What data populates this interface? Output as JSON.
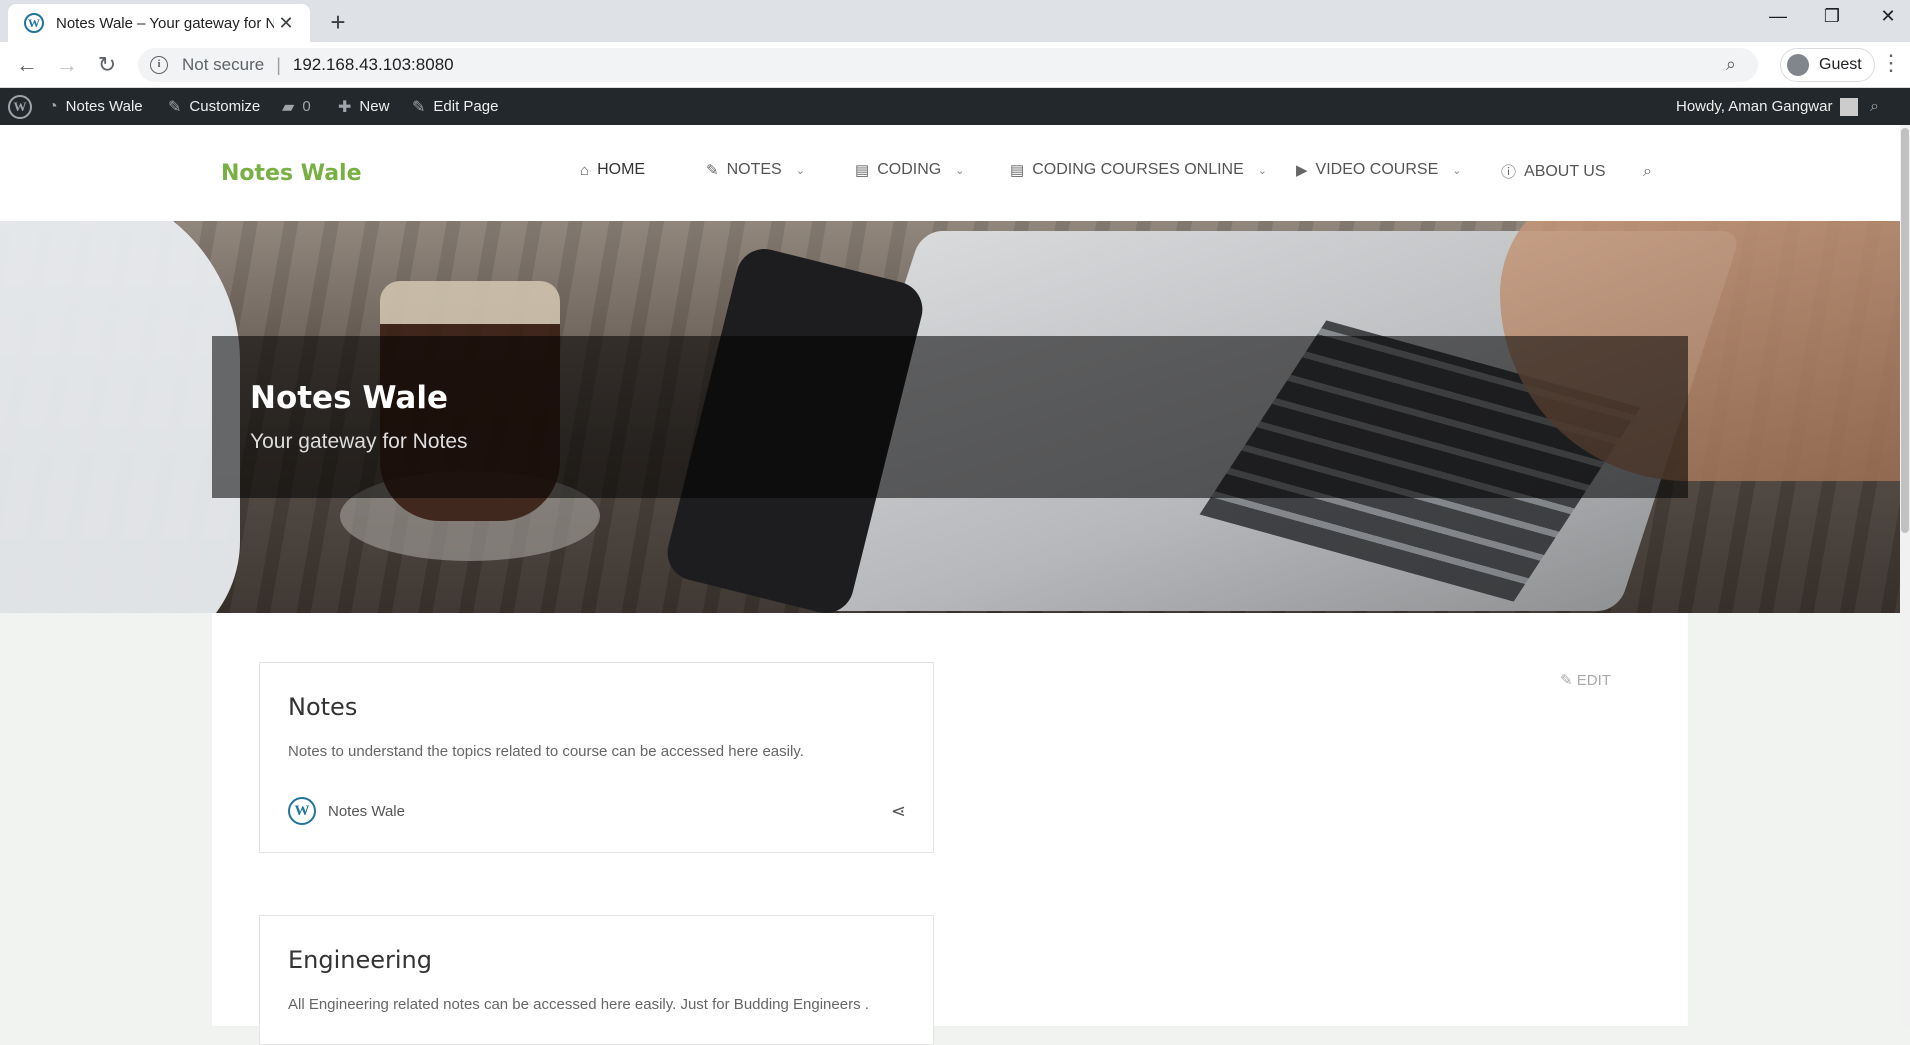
{
  "browser": {
    "tab_title": "Notes Wale – Your gateway for N",
    "tab_favicon": "wordpress-icon",
    "address": {
      "security_label": "Not secure",
      "separator": "|",
      "url": "192.168.43.103:8080"
    },
    "profile": "Guest",
    "icons": {
      "back": "←",
      "forward": "→",
      "reload": "↻",
      "new_tab": "+",
      "close_tab": "✕",
      "minimize": "—",
      "maximize": "❐",
      "close": "✕",
      "zoom": "⌕",
      "menu": "⋮",
      "info": "i"
    }
  },
  "adminbar": {
    "site_name": "Notes Wale",
    "customize": "Customize",
    "comments_count": "0",
    "new": "New",
    "edit_page": "Edit Page",
    "howdy": "Howdy, Aman Gangwar"
  },
  "site": {
    "title": "Notes Wale",
    "accent_color": "#78b043",
    "menu": [
      {
        "label": "HOME",
        "icon": "home-icon"
      },
      {
        "label": "NOTES",
        "icon": "edit-icon",
        "dropdown": true
      },
      {
        "label": "CODING",
        "icon": "file-code-icon",
        "dropdown": true
      },
      {
        "label": "CODING COURSES ONLINE",
        "icon": "file-code-icon",
        "dropdown": true
      },
      {
        "label": "VIDEO COURSE",
        "icon": "video-icon",
        "dropdown": true
      },
      {
        "label": "ABOUT US",
        "icon": "info-icon"
      }
    ]
  },
  "hero": {
    "title": "Notes Wale",
    "tagline": "Your gateway for Notes"
  },
  "content": {
    "edit_label": "EDIT",
    "cards": [
      {
        "title": "Notes",
        "description": "Notes to understand the topics related to course can be accessed here easily.",
        "author": "Notes Wale"
      },
      {
        "title": "Engineering",
        "description": "All Engineering related notes can be accessed here easily. Just for Budding Engineers ."
      }
    ]
  }
}
